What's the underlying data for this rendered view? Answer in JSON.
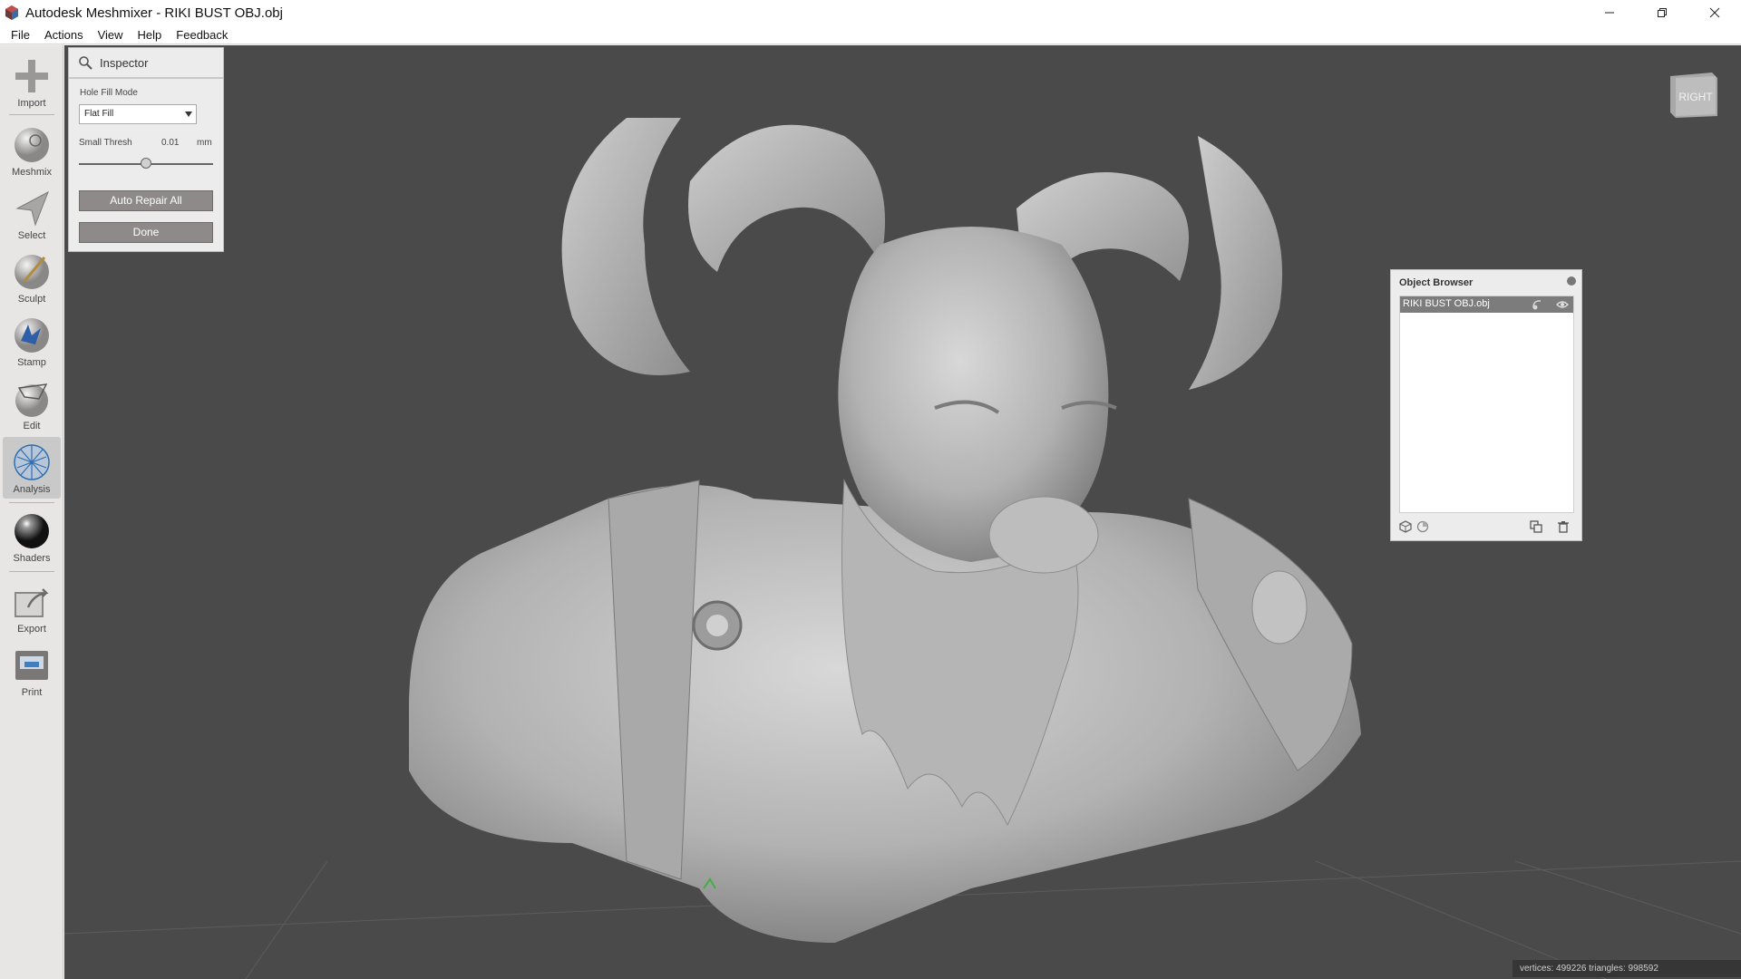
{
  "window": {
    "title": "Autodesk Meshmixer - RIKI BUST OBJ.obj",
    "logo_icon": "meshmixer-logo-icon"
  },
  "menu": [
    "File",
    "Actions",
    "View",
    "Help",
    "Feedback"
  ],
  "toolbar": {
    "tools": [
      {
        "label": "Import",
        "icon": "plus-icon"
      },
      {
        "label": "Meshmix",
        "icon": "meshmix-sphere-icon"
      },
      {
        "label": "Select",
        "icon": "arrow-select-icon"
      },
      {
        "label": "Sculpt",
        "icon": "brush-sphere-icon"
      },
      {
        "label": "Stamp",
        "icon": "stamp-sphere-icon"
      },
      {
        "label": "Edit",
        "icon": "edit-sphere-icon"
      },
      {
        "label": "Analysis",
        "icon": "analysis-sphere-icon",
        "active": true
      },
      {
        "label": "Shaders",
        "icon": "shader-sphere-icon"
      },
      {
        "label": "Export",
        "icon": "export-icon"
      },
      {
        "label": "Print",
        "icon": "printer-icon"
      }
    ]
  },
  "inspector": {
    "title": "Inspector",
    "hole_fill_label": "Hole Fill Mode",
    "hole_fill_value": "Flat Fill",
    "small_thresh_label": "Small Thresh",
    "small_thresh_value": "0.01",
    "small_thresh_unit": "mm",
    "slider_level": 0.5,
    "auto_repair_label": "Auto Repair All",
    "done_label": "Done"
  },
  "viewcube": {
    "face": "RIGHT"
  },
  "object_browser": {
    "title": "Object Browser",
    "objects": [
      {
        "name": "RIKI BUST OBJ.obj",
        "selected": true
      }
    ]
  },
  "status": {
    "text": "vertices: 499226  triangles: 998592"
  },
  "colors": {
    "viewport_bg": "#4a4a4a",
    "model": "#b8b8b8",
    "selected_row": "#7c7c7c",
    "button": "#8e8a8a"
  }
}
